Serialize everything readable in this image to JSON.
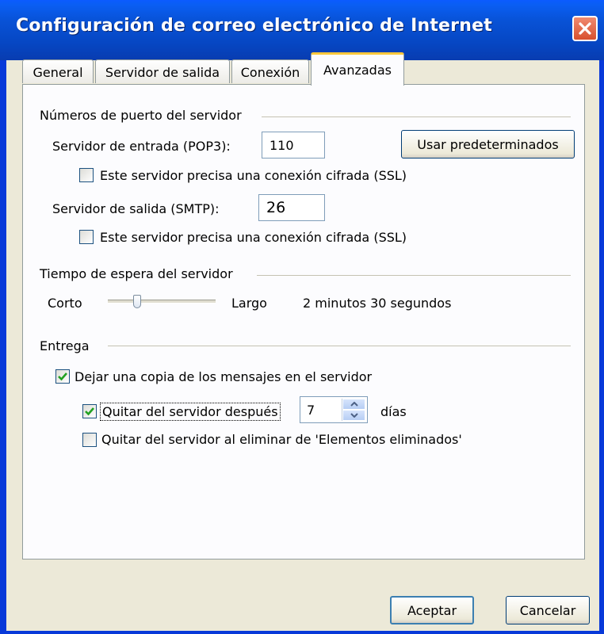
{
  "window": {
    "title": "Configuración de correo electrónico de Internet"
  },
  "tabs": [
    {
      "label": "General"
    },
    {
      "label": "Servidor de salida"
    },
    {
      "label": "Conexión"
    },
    {
      "label": "Avanzadas"
    }
  ],
  "ports": {
    "section_title": "Números de puerto del servidor",
    "incoming_label": "Servidor de entrada (POP3):",
    "incoming_value": "110",
    "defaults_button": "Usar predeterminados",
    "incoming_ssl_label": "Este servidor precisa una conexión cifrada (SSL)",
    "incoming_ssl_checked": false,
    "outgoing_label": "Servidor de salida (SMTP):",
    "outgoing_value": "26",
    "outgoing_ssl_label": "Este servidor precisa una conexión cifrada (SSL)",
    "outgoing_ssl_checked": false
  },
  "timeout": {
    "section_title": "Tiempo de espera del servidor",
    "short_label": "Corto",
    "long_label": "Largo",
    "value_text": "2 minutos 30 segundos",
    "slider_level": 0.25
  },
  "delivery": {
    "section_title": "Entrega",
    "leave_copy_label": "Dejar una copia de los mensajes en el servidor",
    "leave_copy_checked": true,
    "remove_after_label": "Quitar del servidor después",
    "remove_after_checked": true,
    "days_value": "7",
    "days_label": "días",
    "remove_deleted_label": "Quitar del servidor al eliminar de 'Elementos eliminados'",
    "remove_deleted_checked": false
  },
  "footer": {
    "ok_button": "Aceptar",
    "cancel_button": "Cancelar"
  },
  "colors": {
    "titlebar": "#0852d6",
    "close_button": "#d8502e",
    "window_frame": "#0839d9",
    "dialog_background": "#ece9d8",
    "active_tab_highlight": "#ffc83c",
    "checkmark": "#21a121"
  }
}
